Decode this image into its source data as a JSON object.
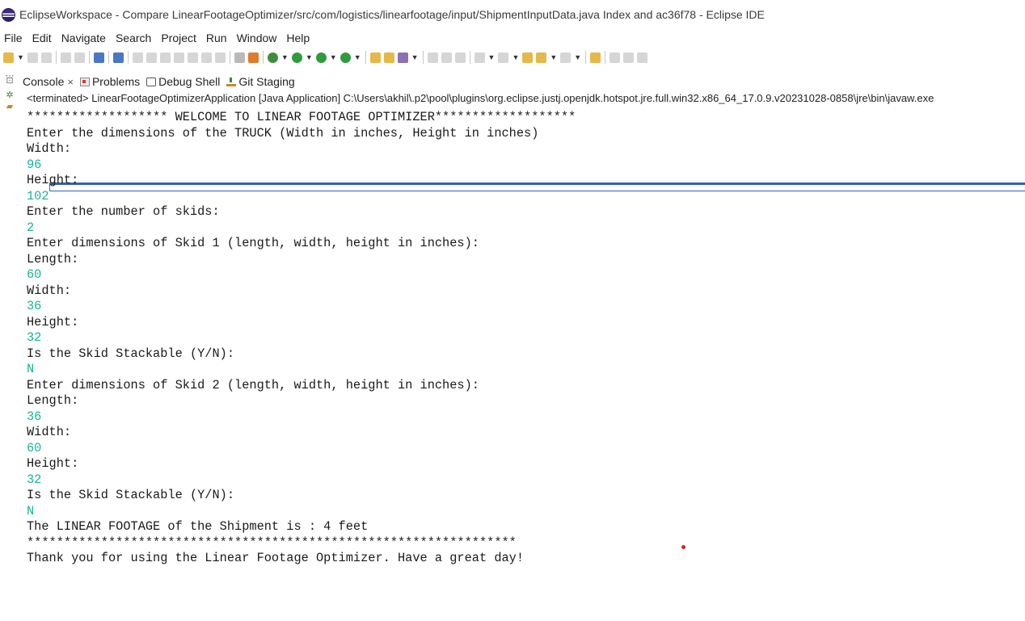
{
  "window": {
    "title": "EclipseWorkspace - Compare LinearFootageOptimizer/src/com/logistics/linearfootage/input/ShipmentInputData.java Index and ac36f78 - Eclipse IDE"
  },
  "menu": [
    "File",
    "Edit",
    "Navigate",
    "Search",
    "Project",
    "Run",
    "Window",
    "Help"
  ],
  "tabs": [
    {
      "label": "Console",
      "icon": "console-icon",
      "closable": true
    },
    {
      "label": "Problems",
      "icon": "problems-icon"
    },
    {
      "label": "Debug Shell",
      "icon": "debug-shell-icon"
    },
    {
      "label": "Git Staging",
      "icon": "git-staging-icon"
    }
  ],
  "console": {
    "status": "<terminated> LinearFootageOptimizerApplication [Java Application] C:\\Users\\akhil\\.p2\\pool\\plugins\\org.eclipse.justj.openjdk.hotspot.jre.full.win32.x86_64_17.0.9.v20231028-0858\\jre\\bin\\javaw.exe",
    "lines": [
      {
        "text": "******************* WELCOME TO LINEAR FOOTAGE OPTIMIZER*******************",
        "input": false
      },
      {
        "text": "Enter the dimensions of the TRUCK (Width in inches, Height in inches)",
        "input": false
      },
      {
        "text": "Width:",
        "input": false
      },
      {
        "text": "96",
        "input": true
      },
      {
        "text": "Height:",
        "input": false
      },
      {
        "text": "102",
        "input": true
      },
      {
        "text": "Enter the number of skids:",
        "input": false
      },
      {
        "text": "2",
        "input": true
      },
      {
        "text": "Enter dimensions of Skid 1 (length, width, height in inches):",
        "input": false
      },
      {
        "text": "Length:",
        "input": false
      },
      {
        "text": "60",
        "input": true
      },
      {
        "text": "Width:",
        "input": false
      },
      {
        "text": "36",
        "input": true
      },
      {
        "text": "Height:",
        "input": false
      },
      {
        "text": "32",
        "input": true
      },
      {
        "text": "Is the Skid Stackable (Y/N):",
        "input": false
      },
      {
        "text": "N",
        "input": true
      },
      {
        "text": "Enter dimensions of Skid 2 (length, width, height in inches):",
        "input": false
      },
      {
        "text": "Length:",
        "input": false
      },
      {
        "text": "36",
        "input": true
      },
      {
        "text": "Width:",
        "input": false
      },
      {
        "text": "60",
        "input": true
      },
      {
        "text": "Height:",
        "input": false
      },
      {
        "text": "32",
        "input": true
      },
      {
        "text": "Is the Skid Stackable (Y/N):",
        "input": false
      },
      {
        "text": "N",
        "input": true
      },
      {
        "text": "The LINEAR FOOTAGE of the Shipment is : 4 feet",
        "input": false
      },
      {
        "text": "******************************************************************",
        "input": false
      },
      {
        "text": "Thank you for using the Linear Footage Optimizer. Have a great day!",
        "input": false
      }
    ]
  },
  "colors": {
    "input_text": "#17b39a",
    "output_text": "#1a1a1a"
  }
}
